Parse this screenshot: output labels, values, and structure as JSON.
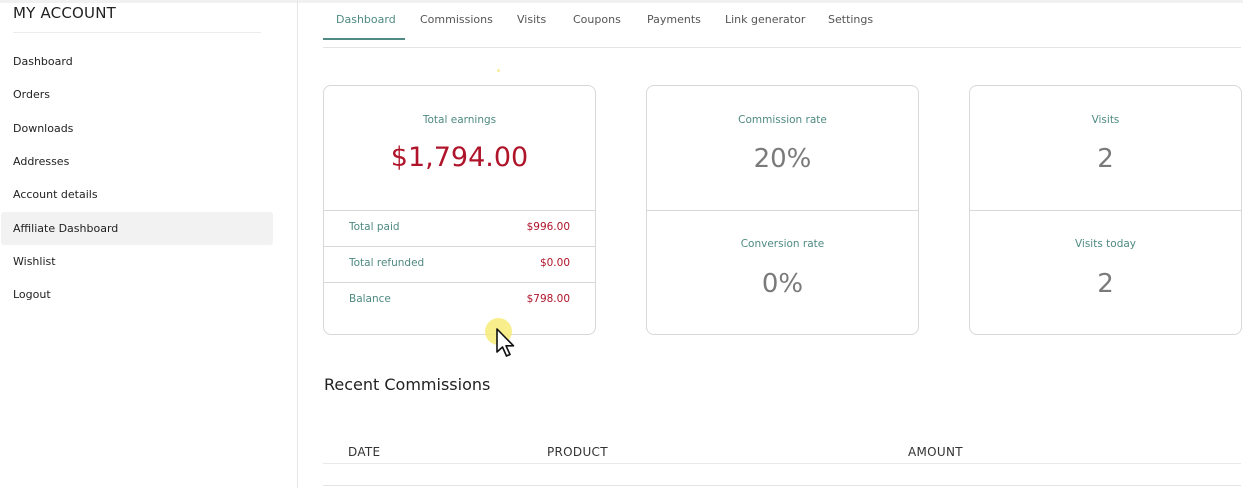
{
  "sidebar": {
    "title": "MY ACCOUNT",
    "items": [
      {
        "label": "Dashboard",
        "active": false
      },
      {
        "label": "Orders",
        "active": false
      },
      {
        "label": "Downloads",
        "active": false
      },
      {
        "label": "Addresses",
        "active": false
      },
      {
        "label": "Account details",
        "active": false
      },
      {
        "label": "Affiliate Dashboard",
        "active": true
      },
      {
        "label": "Wishlist",
        "active": false
      },
      {
        "label": "Logout",
        "active": false
      }
    ]
  },
  "tabs": [
    {
      "label": "Dashboard",
      "active": true
    },
    {
      "label": "Commissions",
      "active": false
    },
    {
      "label": "Visits",
      "active": false
    },
    {
      "label": "Coupons",
      "active": false
    },
    {
      "label": "Payments",
      "active": false
    },
    {
      "label": "Link generator",
      "active": false
    },
    {
      "label": "Settings",
      "active": false
    }
  ],
  "earnings_card": {
    "label": "Total earnings",
    "value": "$1,794.00",
    "rows": [
      {
        "label": "Total paid",
        "value": "$996.00"
      },
      {
        "label": "Total refunded",
        "value": "$0.00"
      },
      {
        "label": "Balance",
        "value": "$798.00"
      }
    ]
  },
  "rate_card": {
    "top_label": "Commission rate",
    "top_value": "20%",
    "bottom_label": "Conversion rate",
    "bottom_value": "0%"
  },
  "visits_card": {
    "top_label": "Visits",
    "top_value": "2",
    "bottom_label": "Visits today",
    "bottom_value": "2"
  },
  "recent_commissions": {
    "title": "Recent Commissions",
    "columns": [
      "DATE",
      "PRODUCT",
      "AMOUNT"
    ]
  },
  "colors": {
    "accent": "#4f8a82",
    "money": "#b0142a",
    "active_nav_bg": "#f2f2f2"
  },
  "icons": [
    "mouse-pointer-icon"
  ]
}
